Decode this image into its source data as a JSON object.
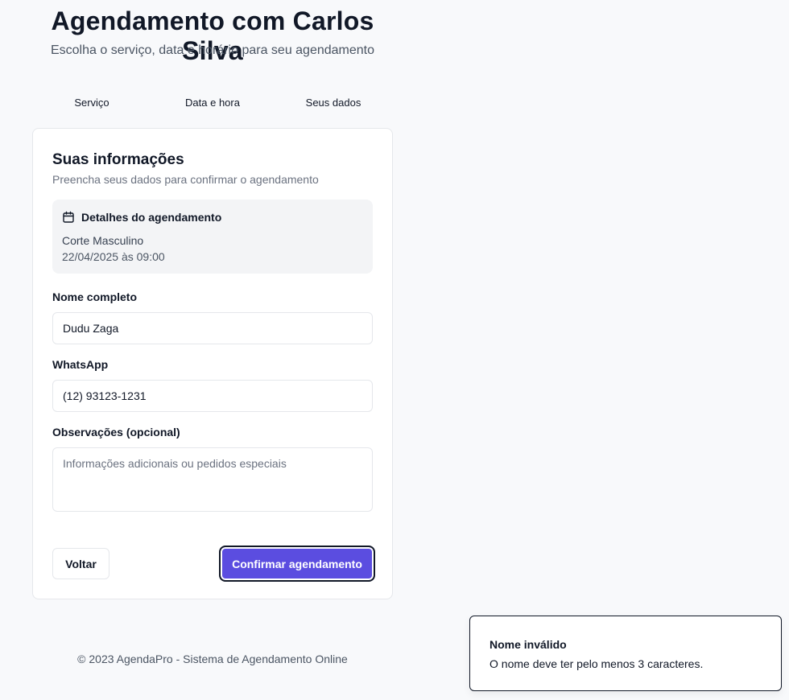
{
  "header": {
    "title": "Agendamento com Carlos Silva",
    "subtitle": "Escolha o serviço, data e horário para seu agendamento"
  },
  "steps": [
    {
      "label": "Serviço"
    },
    {
      "label": "Data e hora"
    },
    {
      "label": "Seus dados"
    }
  ],
  "card": {
    "title": "Suas informações",
    "description": "Preencha seus dados para confirmar o agendamento",
    "details": {
      "icon": "calendar-icon",
      "title": "Detalhes do agendamento",
      "service": "Corte Masculino",
      "datetime": "22/04/2025 às 09:00"
    },
    "form": {
      "name_label": "Nome completo",
      "name_value": "Dudu Zaga",
      "whatsapp_label": "WhatsApp",
      "whatsapp_value": "(12) 93123-1231",
      "notes_label": "Observações (opcional)",
      "notes_value": "",
      "notes_placeholder": "Informações adicionais ou pedidos especiais"
    },
    "buttons": {
      "back": "Voltar",
      "confirm": "Confirmar agendamento"
    }
  },
  "footer": {
    "text": "© 2023 AgendaPro - Sistema de Agendamento Online"
  },
  "toast": {
    "title": "Nome inválido",
    "message": "O nome deve ter pelo menos 3 caracteres."
  },
  "colors": {
    "accent": "#5b4de0",
    "background": "#f8f9fb"
  }
}
